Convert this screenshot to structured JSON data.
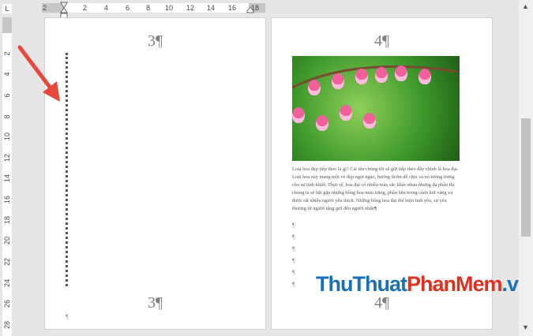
{
  "ruler": {
    "corner": "L",
    "h_ticks": [
      "2",
      "2",
      "4",
      "6",
      "8",
      "10",
      "12",
      "14",
      "16",
      "18"
    ],
    "v_ticks": [
      "2",
      "4",
      "6",
      "8",
      "10",
      "12",
      "14",
      "16",
      "18",
      "20",
      "22",
      "24",
      "26",
      "28"
    ]
  },
  "page3": {
    "header": "3¶",
    "footer": "3¶",
    "mark": "¶"
  },
  "page4": {
    "header": "4¶",
    "footer": "4¶",
    "body": "Loài hoa đẹp tiếp theo là gì? Cái tên chúng tôi sẽ gửi tiếp theo đây chính là hoa đại. Loài hoa này mang một vẻ đẹp ngọt ngào, hương thơm dễ chịu và nó tượng trưng cho sự tinh khiết. Thực tế, hoa đại có nhiều màu sắc khác nhau nhưng đa phần thì chúng ta sẽ bắt gặp những bông hoa màu trắng, phần bên trong cánh hơi vàng và được rất nhiều người yêu thích. Những bông hoa đại thể hiện tình yêu, sự yêu thương từ người tặng gửi đến người nhận¶",
    "marks": [
      "¶",
      "¶",
      "¶",
      "¶",
      "¶",
      "¶"
    ]
  },
  "watermark": {
    "part1": "ThuThuat",
    "part2": "PhanMem",
    "part3": ".vn"
  },
  "scrollbar": {
    "up": "▲",
    "down": "▼"
  }
}
